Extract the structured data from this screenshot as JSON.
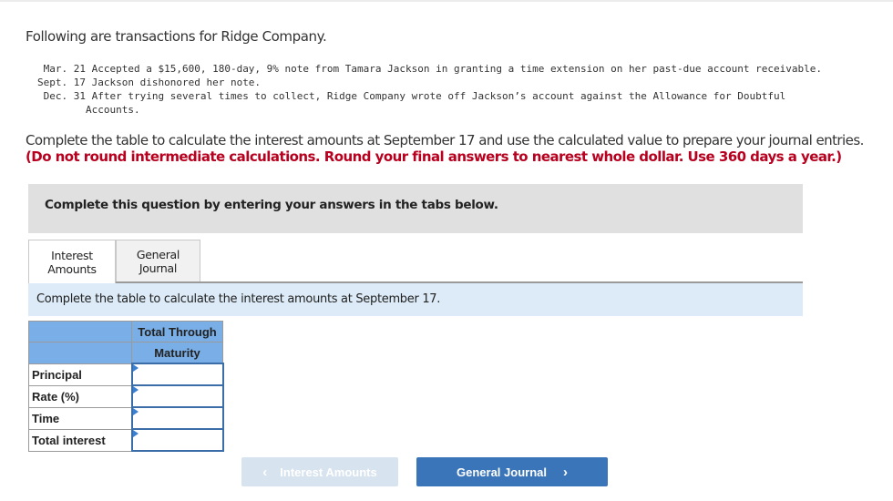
{
  "intro": "Following are transactions for Ridge Company.",
  "transactions": [
    {
      "date": "Mar. 21",
      "text": "Accepted a $15,600, 180-day, 9% note from Tamara Jackson in granting a time extension on her past-due account receivable."
    },
    {
      "date": "Sept. 17",
      "text": "Jackson dishonored her note."
    },
    {
      "date": "Dec. 31",
      "text": "After trying several times to collect, Ridge Company wrote off Jackson’s account against the Allowance for Doubtful",
      "continuation": "Accounts."
    }
  ],
  "instructions": {
    "main": "Complete the table to calculate the interest amounts at September 17 and use the calculated value to prepare your journal entries.",
    "emphasis": "(Do not round intermediate calculations. Round your final answers to nearest whole dollar. Use 360 days a year.)"
  },
  "panel": {
    "text": "Complete this question by entering your answers in the tabs below."
  },
  "tabs": [
    {
      "line1": "Interest",
      "line2": "Amounts",
      "active": true
    },
    {
      "line1": "General",
      "line2": "Journal",
      "active": false
    }
  ],
  "info_bar": "Complete the table to calculate the interest amounts at September 17.",
  "table": {
    "header_line1": "Total Through",
    "header_line2": "Maturity",
    "rows": [
      {
        "label": "Principal",
        "value": ""
      },
      {
        "label": "Rate (%)",
        "value": ""
      },
      {
        "label": "Time",
        "value": ""
      },
      {
        "label": "Total interest",
        "value": ""
      }
    ]
  },
  "nav": {
    "prev_label": "Interest Amounts",
    "prev_icon": "chevron-left-icon",
    "next_label": "General Journal",
    "next_icon": "chevron-right-icon"
  },
  "colors": {
    "emphasis_red": "#b8001f",
    "table_header_blue": "#7aaee6",
    "input_border_blue": "#3b6ea8",
    "next_button_blue": "#3a75b9",
    "prev_button_disabled": "#d8e3f0",
    "info_bar_bg": "#dcebf7",
    "panel_bg": "#e0e0e0"
  }
}
